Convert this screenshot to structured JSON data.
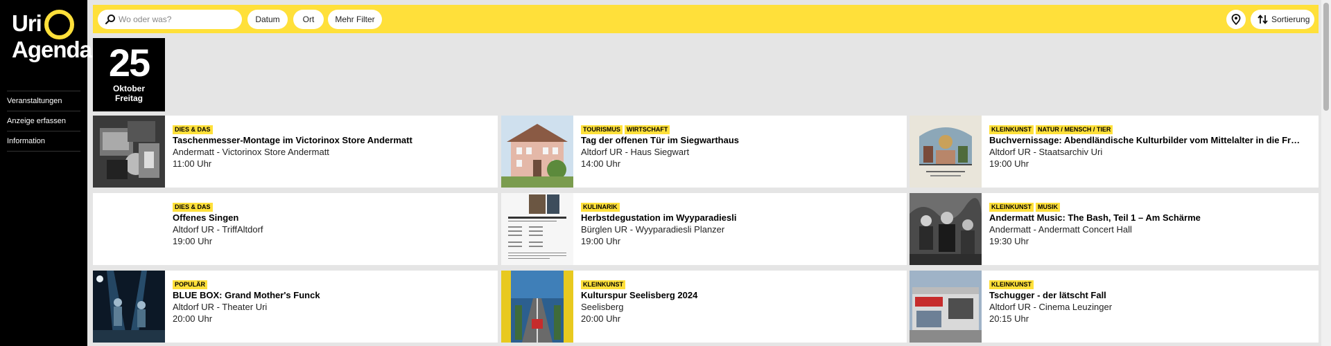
{
  "brand": {
    "line1": "Uri",
    "line2": "Agenda"
  },
  "sidebar": {
    "items": [
      {
        "label": "Veranstaltungen"
      },
      {
        "label": "Anzeige erfassen"
      },
      {
        "label": "Information"
      }
    ]
  },
  "topbar": {
    "search_placeholder": "Wo oder was?",
    "filters": [
      {
        "label": "Datum"
      },
      {
        "label": "Ort"
      },
      {
        "label": "Mehr Filter"
      }
    ],
    "sort_label": "Sortierung",
    "accent_color": "#ffe03a"
  },
  "date": {
    "day": "25",
    "month": "Oktober",
    "weekday": "Freitag"
  },
  "events": [
    {
      "tags": [
        "DIES & DAS"
      ],
      "title": "Taschenmesser-Montage im Victorinox Store Andermatt",
      "place": "Andermatt - Victorinox Store Andermatt",
      "time": "11:00 Uhr",
      "image": "workshop-photo"
    },
    {
      "tags": [
        "TOURISMUS",
        "WIRTSCHAFT"
      ],
      "title": "Tag der offenen Tür im Siegwarthaus",
      "place": "Altdorf UR - Haus Siegwart",
      "time": "14:00 Uhr",
      "image": "house-photo"
    },
    {
      "tags": [
        "KLEINKUNST",
        "NATUR / MENSCH / TIER"
      ],
      "title": "Buchvernissage: Abendländische Kulturbilder vom Mittelalter in die Fr…",
      "place": "Altdorf UR - Staatsarchiv Uri",
      "time": "19:00 Uhr",
      "image": "book-cover"
    },
    {
      "tags": [
        "DIES & DAS"
      ],
      "title": "Offenes Singen",
      "place": "Altdorf UR - TriffAltdorf",
      "time": "19:00 Uhr",
      "image": "none"
    },
    {
      "tags": [
        "KULINARIK"
      ],
      "title": "Herbstdegustation im Wyyparadiesli",
      "place": "Bürglen UR - Wyyparadiesli Planzer",
      "time": "19:00 Uhr",
      "image": "flyer"
    },
    {
      "tags": [
        "KLEINKUNST",
        "MUSIK"
      ],
      "title": "Andermatt Music: The Bash, Teil 1 – Am Schärme",
      "place": "Andermatt - Andermatt Concert Hall",
      "time": "19:30 Uhr",
      "image": "band-photo"
    },
    {
      "tags": [
        "POPULÄR"
      ],
      "title": "BLUE BOX: Grand Mother's Funck",
      "place": "Altdorf UR - Theater Uri",
      "time": "20:00 Uhr",
      "image": "stage-photo"
    },
    {
      "tags": [
        "KLEINKUNST"
      ],
      "title": "Kulturspur Seelisberg 2024",
      "place": "Seelisberg",
      "time": "20:00 Uhr",
      "image": "funicular-photo"
    },
    {
      "tags": [
        "KLEINKUNST"
      ],
      "title": "Tschugger - der lätscht Fall",
      "place": "Altdorf UR - Cinema Leuzinger",
      "time": "20:15 Uhr",
      "image": "cinema-photo"
    }
  ]
}
